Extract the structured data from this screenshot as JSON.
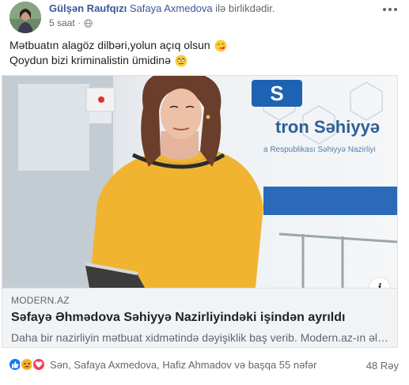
{
  "header": {
    "author": "Gülşən Raufqızı",
    "with_text": "Safaya Axmedova ilə birlikdədir.",
    "tagged_name": "Safaya Axmedova",
    "with_suffix": "ilə birlikdədir.",
    "time": "5 saat",
    "privacy_icon": "globe-icon",
    "more_icon": "more-options-icon"
  },
  "post": {
    "line1": "Mətbuatın alagöz dilbəri,yolun açıq olsun",
    "line1_emoji": "kissing-heart-emoji",
    "line2": "Qoydun bizi kriminalistin ümidinə",
    "line2_emoji": "rolling-eyes-emoji"
  },
  "link": {
    "image_sign_text": "tron Səhiyyə",
    "image_sign_subtext": "a Respublikası Səhiyyə Nazirliyi",
    "domain": "MODERN.AZ",
    "title": "Səfayə Əhmədova Səhiyyə Nazirliyindəki işindən ayrıldı",
    "description": "Daha bir nazirliyin mətbuat xidmətində dəyişiklik baş verib. Modern.az-ın əld...",
    "info_label": "i"
  },
  "reactions": {
    "icons": [
      "like-icon",
      "sad-icon",
      "love-icon"
    ],
    "names": "Sən, Safaya Axmedova, Hafiz Ahmadov və başqa 55 nəfər",
    "comments": "48 Rəy"
  },
  "colors": {
    "link_blue": "#385898",
    "meta_gray": "#616770",
    "like_blue": "#1877f2",
    "love_red": "#f33e58",
    "sad_yellow": "#f7b125",
    "preview_bg": "#f2f3f5"
  }
}
